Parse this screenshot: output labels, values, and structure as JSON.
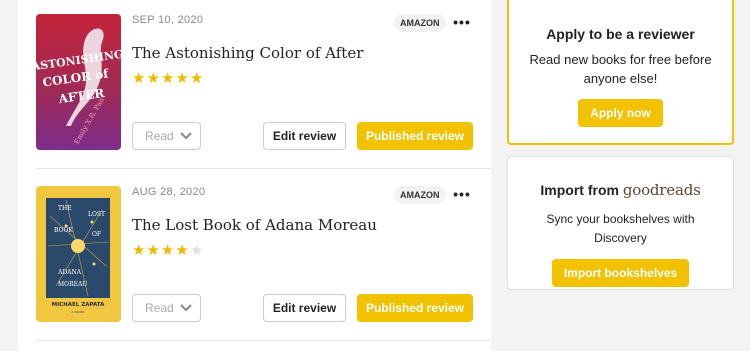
{
  "reviews": [
    {
      "date": "SEP 10, 2020",
      "store": "AMAZON",
      "more": "•••",
      "title": "The Astonishing Color of After",
      "rating": 5,
      "shelf": "Read",
      "edit_label": "Edit review",
      "published_label": "Published review",
      "cover": {
        "bg": "#b0283e",
        "text": "THE ASTONISHING COLOR OF AFTER",
        "author": "Emily X.R. Pan"
      }
    },
    {
      "date": "AUG 28, 2020",
      "store": "AMAZON",
      "more": "•••",
      "title": "The Lost Book of Adana Moreau",
      "rating": 4,
      "shelf": "Read",
      "edit_label": "Edit review",
      "published_label": "Published review",
      "cover": {
        "bg": "#f2c94c",
        "text": "THE LOST BOOK OF ADANA MOREAU",
        "author": "MICHAEL ZAPATA"
      }
    }
  ],
  "sidebar": {
    "apply": {
      "title": "Apply to be a reviewer",
      "desc": "Read new books for free before anyone else!",
      "cta": "Apply now"
    },
    "import": {
      "title_prefix": "Import from",
      "brand": "goodreads",
      "desc": "Sync your bookshelves with Discovery",
      "cta": "Import bookshelves"
    }
  },
  "colors": {
    "accent": "#f2c100",
    "star": "#f0b800"
  }
}
